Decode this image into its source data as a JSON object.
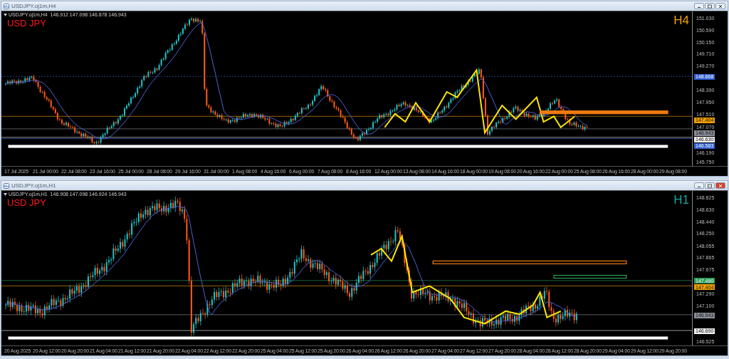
{
  "windows": [
    {
      "title": "USDJPY.oj1m,H4",
      "close_highlighted": false,
      "info": "USDJPY.oj1m,H4  146.912 147.098 146.878 146.943",
      "symbol": "USD JPY",
      "timeframe": {
        "text": "H4",
        "color": "#f0a000"
      },
      "price_ticks": [
        "151.030",
        "150.590",
        "150.150",
        "149.710",
        "149.270",
        "148.390",
        "147.950",
        "147.510",
        "147.070",
        "146.190",
        "145.750"
      ],
      "price_badges": [
        {
          "text": "148.868",
          "color": "#2f5fd0"
        },
        {
          "text": "147.404",
          "color": "#f0a000"
        },
        {
          "text": "146.943",
          "color": "#8a8f99"
        },
        {
          "text": "146.630",
          "color": "#f0f0f0"
        },
        {
          "text": "146.583",
          "color": "#2f5fd0"
        }
      ],
      "time_labels": [
        "17 Jul 2025",
        "21 Jul 00:00",
        "22 Jul 08:00",
        "23 Jul 16:00",
        "25 Jul 00:00",
        "28 Jul 08:00",
        "29 Jul 16:00",
        "31 Jul 00:00",
        "1 Aug 08:00",
        "4 Aug 16:00",
        "6 Aug 00:00",
        "7 Aug 08:00",
        "8 Aug 16:00",
        "12 Aug 00:00",
        "13 Aug 08:00",
        "14 Aug 16:00",
        "18 Aug 00:00",
        "19 Aug 08:00",
        "20 Aug 16:00",
        "22 Aug 00:00",
        "25 Aug 08:00",
        "26 Aug 16:00",
        "28 Aug 00:00",
        "29 Aug 08:00"
      ]
    },
    {
      "title": "USDJPY.oj1m,H1",
      "close_highlighted": true,
      "info": "USDJPY.oj1m,H1  146.908 147.098 146.924 146.943",
      "symbol": "USD JPY",
      "timeframe": {
        "text": "H1",
        "color": "#1aa3a3"
      },
      "price_ticks": [
        "148.825",
        "148.630",
        "148.440",
        "148.250",
        "148.055",
        "147.865",
        "147.675",
        "147.290",
        "147.100",
        "146.525"
      ],
      "price_badges": [
        {
          "text": "147.490",
          "color": "#2e9e5a"
        },
        {
          "text": "147.404",
          "color": "#f0a000"
        },
        {
          "text": "146.943",
          "color": "#8a8f99"
        },
        {
          "text": "146.690",
          "color": "#f0f0f0"
        }
      ],
      "time_labels": [
        "20 Aug 2025",
        "20 Aug 12:00",
        "20 Aug 20:00",
        "21 Aug 04:00",
        "21 Aug 12:00",
        "21 Aug 20:00",
        "22 Aug 04:00",
        "22 Aug 12:00",
        "22 Aug 20:00",
        "25 Aug 04:00",
        "25 Aug 12:00",
        "25 Aug 20:00",
        "26 Aug 04:00",
        "26 Aug 12:00",
        "26 Aug 20:00",
        "27 Aug 04:00",
        "27 Aug 12:00",
        "27 Aug 20:00",
        "28 Aug 04:00",
        "28 Aug 12:00",
        "28 Aug 20:00",
        "29 Aug 04:00",
        "29 Aug 12:00",
        "29 Aug 20:00"
      ]
    }
  ]
}
